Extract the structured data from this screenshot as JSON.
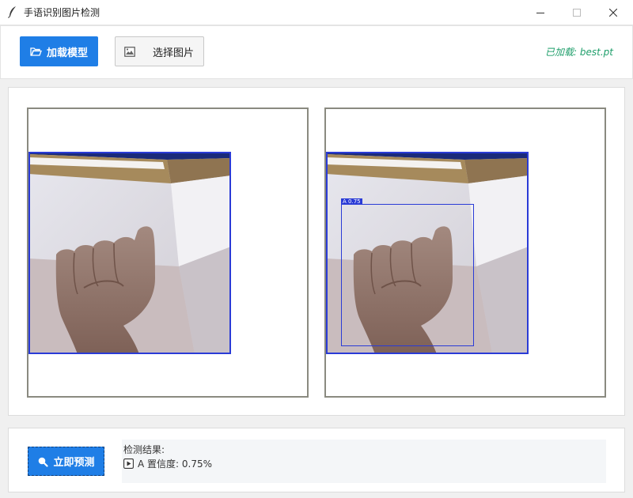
{
  "window": {
    "title": "手语识别图片检测",
    "icons": {
      "app": "feather-icon",
      "minimize": "minimize-icon",
      "maximize": "maximize-icon",
      "close": "close-icon"
    }
  },
  "toolbar": {
    "load_model_label": "加载模型",
    "load_model_icon": "folder-open-icon",
    "select_image_label": "选择图片",
    "select_image_icon": "broken-image-icon",
    "model_status": "已加载: best.pt",
    "colors": {
      "primary": "#1f7ee6",
      "status": "#1e9e6a"
    }
  },
  "images": {
    "detection": {
      "label": "A 0.75",
      "color": "#2a3bd6"
    }
  },
  "bottom": {
    "predict_label": "立即预测",
    "predict_icon": "search-icon",
    "result_title": "检测结果:",
    "result_icon": "play-icon",
    "result_text": "A 置信度: 0.75%"
  }
}
